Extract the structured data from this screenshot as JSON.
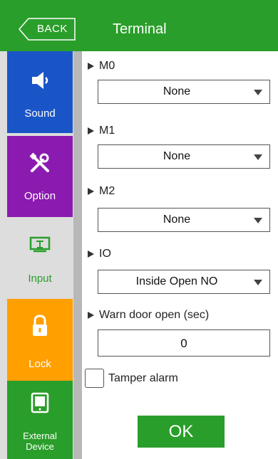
{
  "header": {
    "back_label": "BACK",
    "title": "Terminal"
  },
  "sidebar": {
    "items": [
      {
        "label": "Sound",
        "color": "#1a55c8",
        "icon": "speaker-icon"
      },
      {
        "label": "Option",
        "color": "#8b1bb0",
        "icon": "tools-icon"
      },
      {
        "label": "Input",
        "color": "#dddddd",
        "icon": "monitor-input-icon",
        "selected": true
      },
      {
        "label": "Lock",
        "color": "#ff9f00",
        "icon": "lock-icon"
      },
      {
        "label": "External\nDevice",
        "color": "#2a9e2a",
        "icon": "device-icon"
      }
    ]
  },
  "form": {
    "m0": {
      "label": "M0",
      "value": "None"
    },
    "m1": {
      "label": "M1",
      "value": "None"
    },
    "m2": {
      "label": "M2",
      "value": "None"
    },
    "io": {
      "label": "IO",
      "value": "Inside Open NO"
    },
    "warn": {
      "label": "Warn door open (sec)",
      "value": "0"
    },
    "tamper": {
      "label": "Tamper alarm",
      "checked": false
    },
    "ok_label": "OK"
  }
}
